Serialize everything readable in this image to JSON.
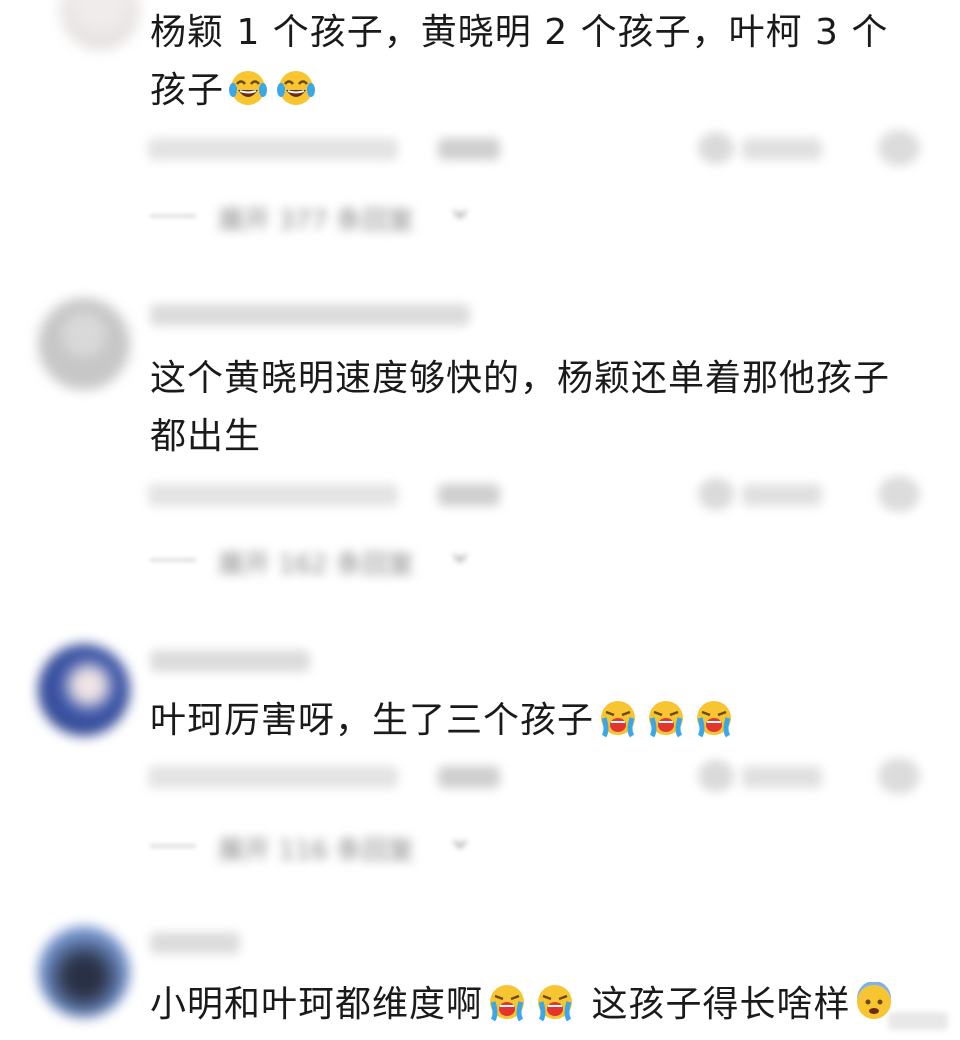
{
  "comments": [
    {
      "text": "杨颖 1 个孩子，黄晓明 2 个孩子，叶柯 3 个孩子",
      "emojis": [
        "laughing-tears-emoji",
        "laughing-tears-emoji"
      ],
      "expand_label": "展开 377 条回复"
    },
    {
      "text": "这个黄晓明速度够快的，杨颖还单着那他孩子都出生",
      "emojis": [],
      "expand_label": "展开 162 条回复"
    },
    {
      "text": "叶珂厉害呀，生了三个孩子",
      "emojis": [
        "loudly-crying-emoji",
        "loudly-crying-emoji",
        "loudly-crying-emoji"
      ],
      "expand_label": "展开 116 条回复"
    },
    {
      "text_part1": "小明和叶珂都维度啊",
      "text_part2": "这孩子得长啥样",
      "emojis": [
        "loudly-crying-emoji",
        "loudly-crying-emoji",
        "cold-sweat-emoji"
      ]
    }
  ],
  "colors": {
    "text": "#1a1a1a",
    "emoji_yellow": "#f7c531",
    "emoji_tear": "#39a7e8",
    "emoji_mouth": "#e3352f"
  }
}
